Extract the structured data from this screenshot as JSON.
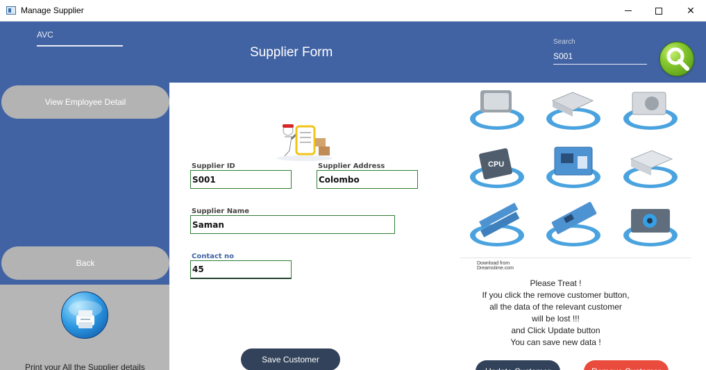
{
  "window": {
    "title": "Manage Supplier"
  },
  "header": {
    "user": "AVC",
    "form_title": "Supplier Form",
    "search_label": "Search",
    "search_value": "S001"
  },
  "sidebar": {
    "view_button": "View Employee Detail",
    "back_button": "Back",
    "print_caption": "Print your All the Supplier details"
  },
  "form": {
    "supplier_id_label": "Supplier ID",
    "supplier_id": "S001",
    "supplier_address_label": "Supplier Address",
    "supplier_address": "Colombo",
    "supplier_name_label": "Supplier Name",
    "supplier_name": "Saman",
    "contact_label": "Contact no",
    "contact": "45"
  },
  "buttons": {
    "save": "Save Customer",
    "update": "Update Customer",
    "remove": "Remove Customer"
  },
  "hardware_image": {
    "cpu_label": "CPU",
    "download_text": "Download from",
    "site_text": "Dreamstime.com"
  },
  "notice": {
    "heading": "Please Treat !",
    "line1": "If you click the remove customer button,",
    "line2": "all the data of the relevant customer",
    "line3": "will be lost !!!",
    "line4": "and Click Update button",
    "line5": "You can save new data !"
  },
  "colors": {
    "header_blue": "#4263a3",
    "save_button": "#31425a",
    "remove_button": "#e94b3c",
    "input_border": "#2e7d32"
  },
  "icons": {
    "app": "app-window-icon",
    "search": "magnifier-icon",
    "print": "printer-icon",
    "logo": "delivery-robot-icon"
  }
}
